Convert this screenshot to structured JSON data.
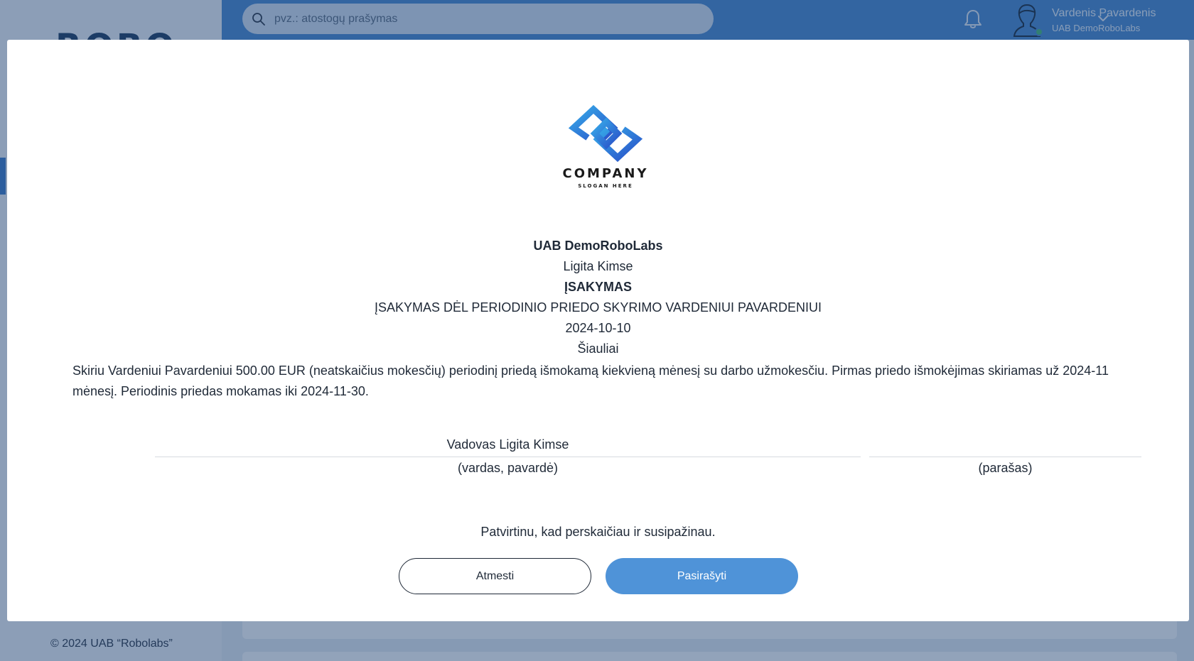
{
  "sidebar": {
    "logo_text": "ROBO",
    "footer": "© 2024 UAB “Robolabs”"
  },
  "topbar": {
    "search_placeholder": "pvz.: atostogų prašymas",
    "user_name": "Vardenis Pavardenis",
    "user_company": "UAB DemoRoboLabs"
  },
  "modal": {
    "logo": {
      "company": "COMPANY",
      "slogan": "SLOGAN HERE"
    },
    "company_name": "UAB DemoRoboLabs",
    "director": "Ligita Kimse",
    "doc_type": "ĮSAKYMAS",
    "doc_title": "ĮSAKYMAS DĖL PERIODINIO PRIEDO SKYRIMO VARDENIUI PAVARDENIUI",
    "date": "2024-10-10",
    "city": "Šiauliai",
    "body": "Skiriu Vardeniui Pavardeniui 500.00 EUR (neatskaičius mokesčių) periodinį priedą išmokamą kiekvieną mėnesį su darbo užmokesčiu. Pirmas priedo išmokėjimas skiriamas už 2024-11 mėnesį. Periodinis priedas mokamas iki 2024-11-30.",
    "signatory": "Vadovas Ligita Kimse",
    "name_caption": "(vardas, pavardė)",
    "signature_caption": "(parašas)",
    "confirm_text": "Patvirtinu, kad perskaičiau ir susipažinau.",
    "reject_label": "Atmesti",
    "sign_label": "Pasirašyti"
  },
  "colors": {
    "topbar": "#4a89d0",
    "primary_button": "#4f93d8",
    "status_online": "#48bb78"
  }
}
